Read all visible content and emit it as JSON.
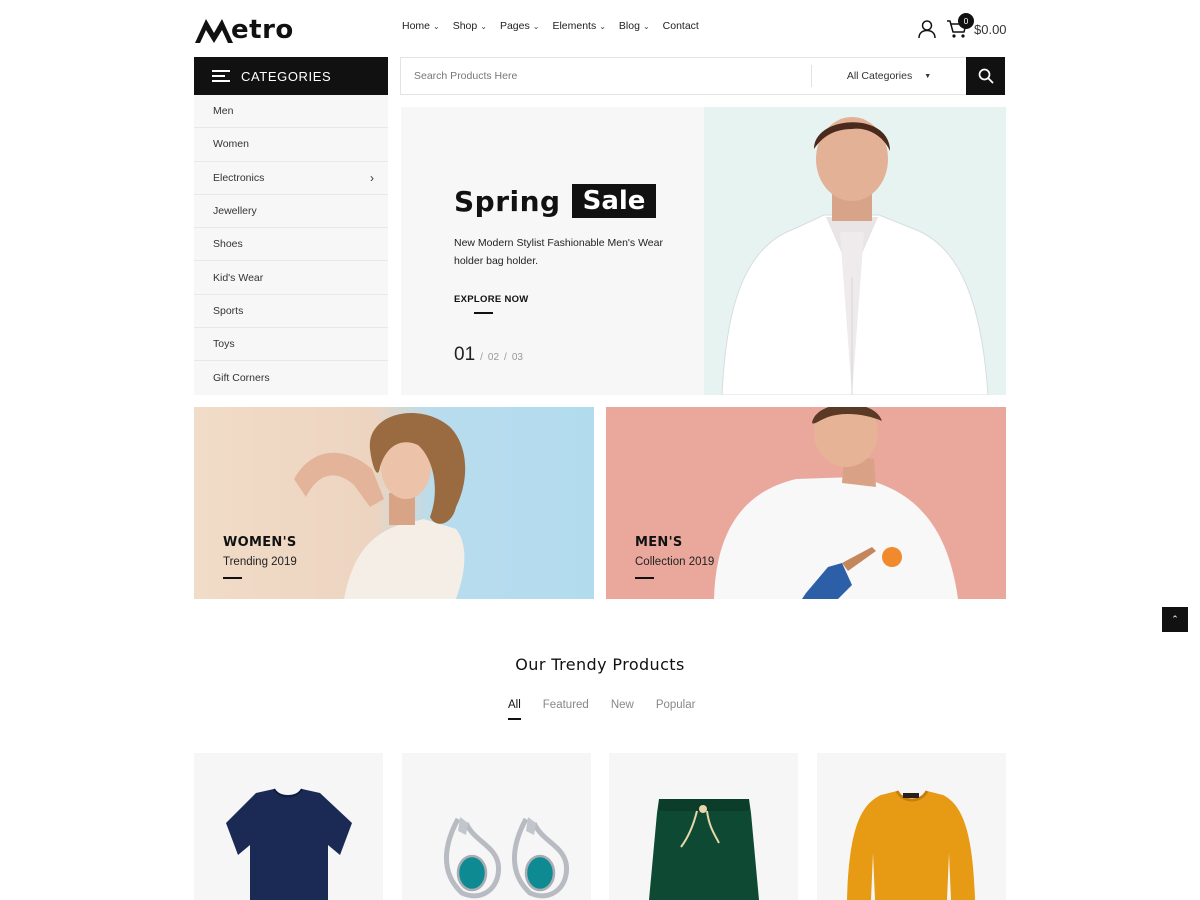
{
  "header": {
    "logo_text": "etro",
    "nav": [
      "Home",
      "Shop",
      "Pages",
      "Elements",
      "Blog",
      "Contact"
    ],
    "cart_count": "0",
    "cart_total": "$0.00"
  },
  "categories": {
    "title": "CATEGORIES",
    "items": [
      "Men",
      "Women",
      "Electronics",
      "Jewellery",
      "Shoes",
      "Kid's Wear",
      "Sports",
      "Toys",
      "Gift Corners"
    ]
  },
  "search": {
    "placeholder": "Search Products Here",
    "category": "All Categories"
  },
  "hero": {
    "title_1": "Spring",
    "title_2": "Sale",
    "description": "New Modern Stylist Fashionable Men's Wear holder bag holder.",
    "cta": "EXPLORE NOW",
    "slide_current": "01",
    "slide_2": "02",
    "slide_3": "03"
  },
  "banners": {
    "women_title": "WOMEN'S",
    "women_sub": "Trending 2019",
    "men_title": "MEN'S",
    "men_sub": "Collection 2019"
  },
  "products": {
    "title": "Our Trendy Products",
    "tabs": [
      "All",
      "Featured",
      "New",
      "Popular"
    ]
  },
  "colors": {
    "primary": "#111111",
    "hero_right_bg": "#e6f3f1",
    "men_banner_bg": "#eaa89c",
    "card_bg": "#f6f6f6"
  }
}
